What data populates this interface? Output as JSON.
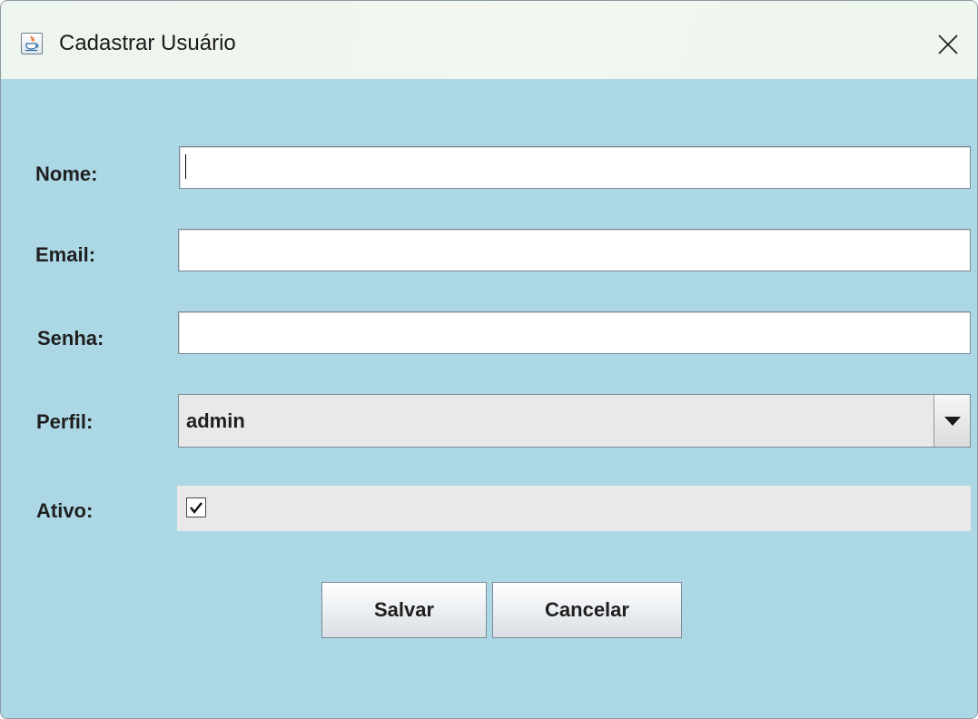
{
  "window": {
    "title": "Cadastrar Usuário",
    "icon": "java-cup-icon",
    "close_icon": "close-icon"
  },
  "form": {
    "nome": {
      "label": "Nome:",
      "value": ""
    },
    "email": {
      "label": "Email:",
      "value": ""
    },
    "senha": {
      "label": "Senha:",
      "value": ""
    },
    "perfil": {
      "label": "Perfil:",
      "selected": "admin"
    },
    "ativo": {
      "label": "Ativo:",
      "checked": true
    }
  },
  "buttons": {
    "salvar": "Salvar",
    "cancelar": "Cancelar"
  },
  "colors": {
    "background": "#acd8e6",
    "titlebar": "#eef4ee",
    "field": "#ffffff",
    "combo": "#e9e9e9"
  }
}
